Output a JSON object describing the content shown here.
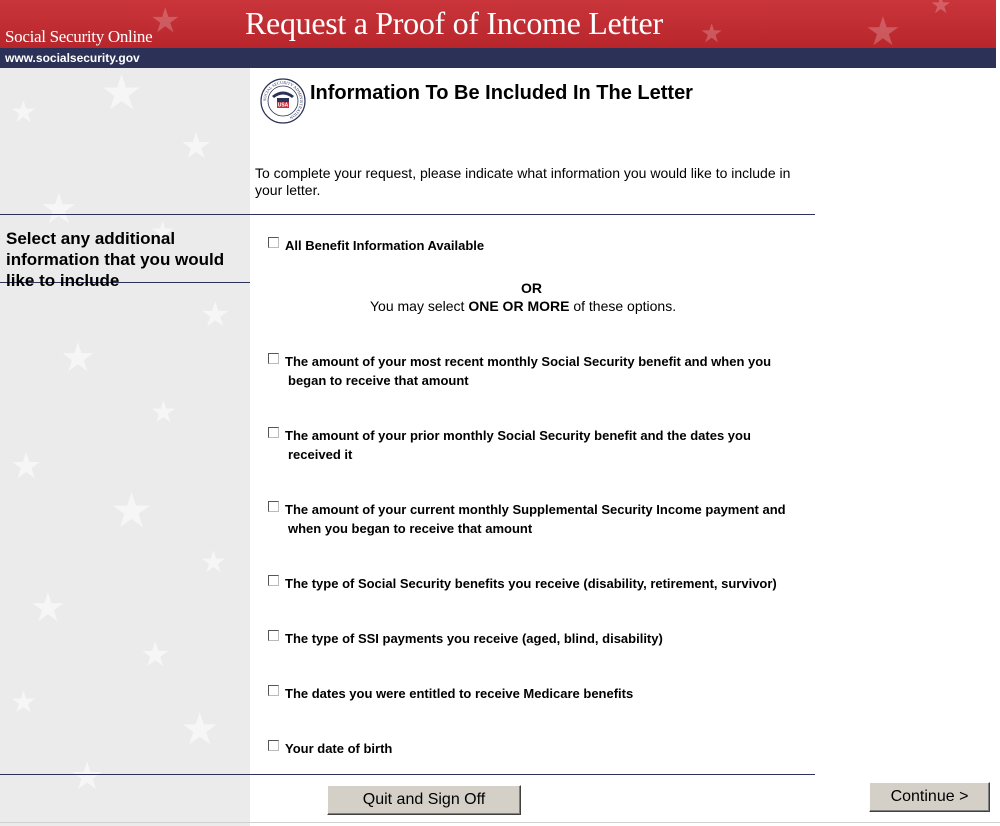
{
  "header": {
    "brand": "Social Security Online",
    "url": "www.socialsecurity.gov",
    "banner_title": "Request a Proof of Income Letter"
  },
  "sidebar": {
    "heading": "Select any additional information that you would like to include"
  },
  "main": {
    "title": "Information To Be Included In The Letter",
    "intro": "To complete your request, please indicate what information you would like to include in your letter.",
    "all_option": "All Benefit Information Available",
    "or_label": "OR",
    "or_sub_prefix": "You may select ",
    "or_sub_bold": "ONE OR MORE",
    "or_sub_suffix": " of these options.",
    "options": [
      {
        "line1": "The amount of your most recent monthly Social Security benefit and when you",
        "line2": "began to receive that amount"
      },
      {
        "line1": "The amount of your prior monthly Social Security benefit and the dates you",
        "line2": "received it"
      },
      {
        "line1": "The amount of your current monthly Supplemental Security Income payment and",
        "line2": "when you began to receive that amount"
      },
      {
        "line1": "The type of Social Security benefits you receive (disability, retirement, survivor)",
        "line2": ""
      },
      {
        "line1": "The type of SSI payments you receive (aged, blind, disability)",
        "line2": ""
      },
      {
        "line1": "The dates you were entitled to receive Medicare benefits",
        "line2": ""
      },
      {
        "line1": "Your date of birth",
        "line2": ""
      }
    ]
  },
  "buttons": {
    "quit": "Quit and Sign Off",
    "continue": "Continue >"
  },
  "seal": {
    "ring_text": "SOCIAL SECURITY ADMINISTRATION",
    "center_text": "USA"
  },
  "colors": {
    "header_red": "#c1303a",
    "header_navy": "#2b3157",
    "sidebar_bg": "#ebebeb",
    "button_face": "#d4d0c8"
  }
}
